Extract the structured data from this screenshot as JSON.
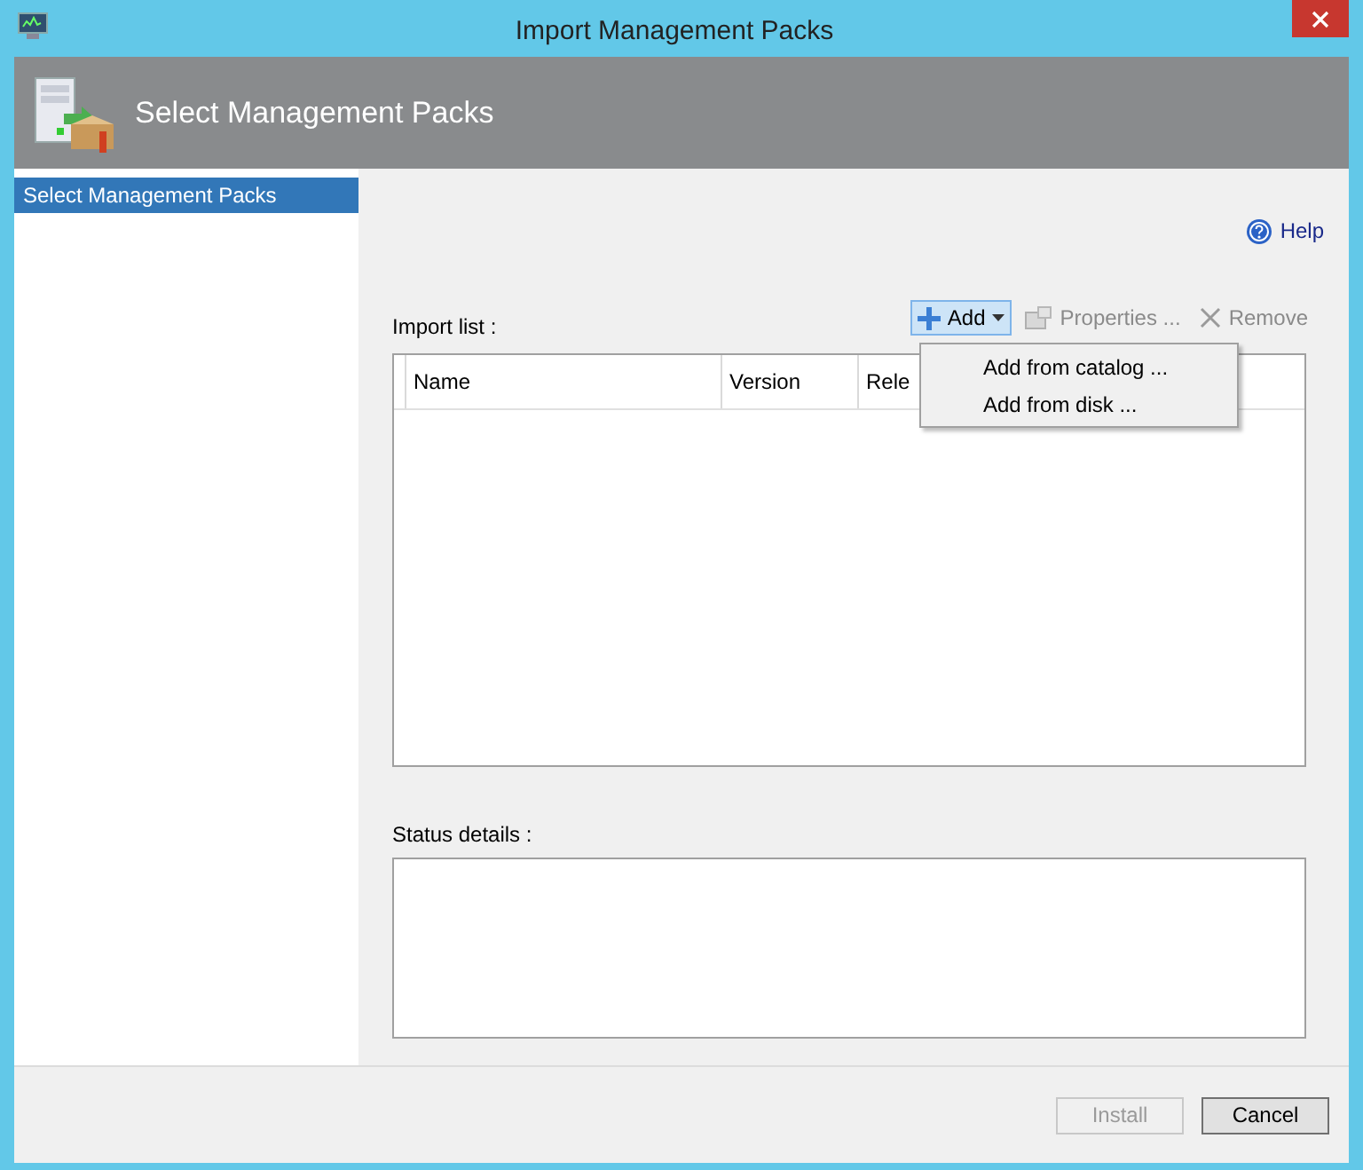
{
  "window": {
    "title": "Import Management Packs"
  },
  "header": {
    "title": "Select Management Packs"
  },
  "sidebar": {
    "items": [
      {
        "label": "Select Management Packs",
        "selected": true
      }
    ]
  },
  "help": {
    "label": "Help"
  },
  "import_list": {
    "label": "Import list :",
    "toolbar": [
      {
        "kind": "add",
        "label": "Add",
        "disabled": false,
        "expanded": true
      },
      {
        "kind": "properties",
        "label": "Properties ...",
        "disabled": true,
        "expanded": false
      },
      {
        "kind": "remove",
        "label": "Remove",
        "disabled": true,
        "expanded": false
      }
    ],
    "menu": [
      {
        "label": "Add from catalog ..."
      },
      {
        "label": "Add from disk ..."
      }
    ],
    "columns": [
      "Name",
      "Version",
      "Rele"
    ]
  },
  "status": {
    "label": "Status details :"
  },
  "buttons": [
    {
      "label": "Install",
      "disabled": true
    },
    {
      "label": "Cancel",
      "disabled": false
    }
  ]
}
